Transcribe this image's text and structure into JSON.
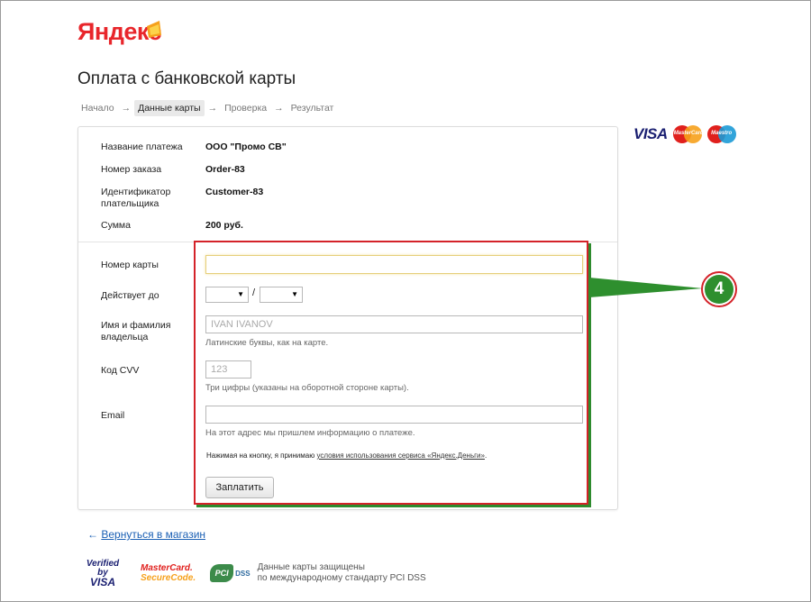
{
  "header": {
    "logo": "Яндекс",
    "title": "Оплата с банковской карты"
  },
  "steps": [
    {
      "label": "Начало",
      "active": false
    },
    {
      "label": "Данные карты",
      "active": true
    },
    {
      "label": "Проверка",
      "active": false
    },
    {
      "label": "Результат",
      "active": false
    }
  ],
  "step_arrow": "→",
  "payment_info": {
    "purpose_label": "Название платежа",
    "purpose_value": "ООО \"Промо СВ\"",
    "order_label": "Номер заказа",
    "order_value": "Order-83",
    "payer_label_line1": "Идентификатор",
    "payer_label_line2": "плательщика",
    "payer_value": "Customer-83",
    "sum_label": "Сумма",
    "sum_value": "200 руб."
  },
  "form": {
    "card_number_label": "Номер карты",
    "card_number_value": "",
    "valid_until_label": "Действует до",
    "month_value": "",
    "year_value": "",
    "date_separator": "/",
    "name_label_line1": "Имя и фамилия",
    "name_label_line2": "владельца",
    "name_placeholder": "IVAN IVANOV",
    "name_hint": "Латинские буквы, как на карте.",
    "cvv_label": "Код CVV",
    "cvv_placeholder": "123",
    "cvv_hint": "Три цифры (указаны на оборотной стороне карты).",
    "email_label": "Email",
    "email_value": "",
    "email_hint": "На этот адрес мы пришлем информацию о платеже.",
    "agree_text": "Нажимая на кнопку, я принимаю ",
    "agree_link": "условия использования сервиса «Яндекс.Деньги»",
    "agree_end": ".",
    "pay_button": "Заплатить"
  },
  "card_brands": {
    "visa": "VISA",
    "mastercard": "MasterCard",
    "maestro": "Maestro"
  },
  "annotation": {
    "number": "4",
    "color_border": "#d42229",
    "color_fill": "#2e8f2e"
  },
  "back_link": {
    "arrow": "←",
    "label": "Вернуться в магазин"
  },
  "footer": {
    "vbv_line1": "Verified by",
    "vbv_line2": "VISA",
    "mc_line1": "MasterCard.",
    "mc_line2": "SecureCode.",
    "pci_mark": "PCI",
    "pci_dss": "DSS",
    "security_line1": "Данные карты защищены",
    "security_line2": "по международному стандарту PCI DSS"
  },
  "colors": {
    "brand_red": "#e8262b",
    "link_blue": "#1a5fb4",
    "highlight_red": "#d42229",
    "annotation_green": "#2e8f2e"
  }
}
